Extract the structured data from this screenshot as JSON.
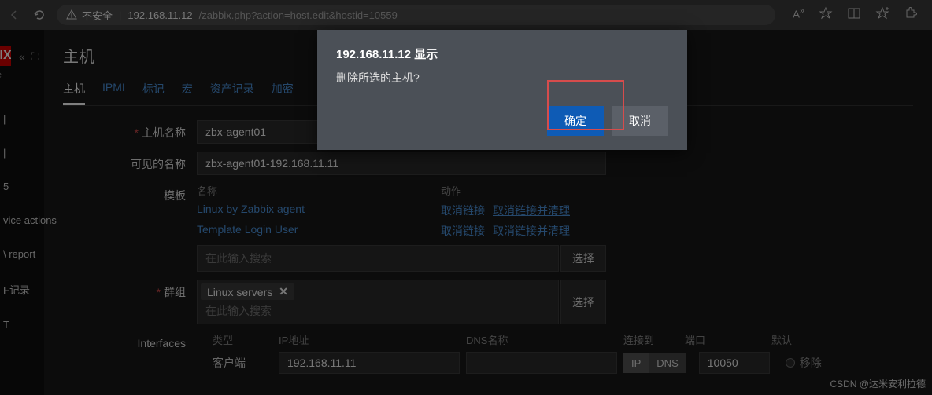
{
  "browser": {
    "security_label": "不安全",
    "url_prefix": "192.168.11.12",
    "url_path": "/zabbix.php?action=host.edit&hostid=10559"
  },
  "logo": "BIX",
  "logo_sub": "ade",
  "side": {
    "i0": "|",
    "i1": "|",
    "i2": "5",
    "i3": "vice actions",
    "i4": "\\ report",
    "i5": "F记录",
    "i6": "T"
  },
  "page": {
    "title": "主机"
  },
  "tabs": {
    "t0": "主机",
    "t1": "IPMI",
    "t2": "标记",
    "t3": "宏",
    "t4": "资产记录",
    "t5": "加密"
  },
  "form": {
    "host_label": "主机名称",
    "host_value": "zbx-agent01",
    "visible_label": "可见的名称",
    "visible_value": "zbx-agent01-192.168.11.11",
    "template_label": "模板",
    "tmpl_name_hdr": "名称",
    "tmpl_act_hdr": "动作",
    "tmpl0": "Linux by Zabbix agent",
    "tmpl1": "Template Login User",
    "unlink": "取消链接",
    "unlink_clear": "取消链接并清理",
    "search_ph": "在此输入搜索",
    "select_btn": "选择",
    "group_label": "群组",
    "group_chip": "Linux servers",
    "interfaces_label": "Interfaces",
    "iface_type_hdr": "类型",
    "iface_ip_hdr": "IP地址",
    "iface_dns_hdr": "DNS名称",
    "iface_conn_hdr": "连接到",
    "iface_port_hdr": "端口",
    "iface_default_hdr": "默认",
    "iface_agent": "客户端",
    "iface_ip": "192.168.11.11",
    "conn_ip": "IP",
    "conn_dns": "DNS",
    "iface_port": "10050",
    "remove": "移除"
  },
  "dialog": {
    "title": "192.168.11.12 显示",
    "message": "删除所选的主机?",
    "ok": "确定",
    "cancel": "取消"
  },
  "watermark": "CSDN @达米安利拉德"
}
